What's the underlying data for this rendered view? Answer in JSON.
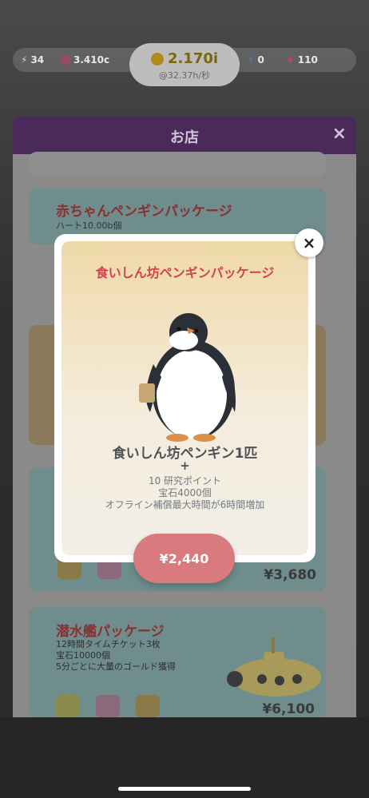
{
  "status_bar": {
    "lightning_count": "34",
    "hearts": "3.410c",
    "gold": "2.170i",
    "gold_rate": "@32.37h/秒",
    "energy": "0",
    "gems": "110"
  },
  "shop": {
    "title": "お店",
    "close_label": "×",
    "cards": [
      {
        "title": "赤ちゃんペンギンパッケージ",
        "desc": "ハート10.00b個"
      },
      {
        "price": "¥3,680"
      },
      {
        "title": "潜水艦パッケージ",
        "desc_lines": [
          "12時間タイムチケット3枚",
          "宝石10000個",
          "5分ごとに大量のゴールド獲得"
        ],
        "price": "¥6,100"
      }
    ]
  },
  "modal": {
    "title": "食いしん坊ペンギンパッケージ",
    "close_label": "×",
    "item_name": "食いしん坊ペンギン1匹",
    "plus": "+",
    "details": [
      "10 研究ポイント",
      "宝石4000個",
      "オフライン補償最大時間が6時間増加"
    ],
    "buy_label": "¥2,440"
  },
  "colors": {
    "modal_title": "#d2434f",
    "buy_button": "#d87a7e",
    "shop_header": "#4a2a5a"
  }
}
